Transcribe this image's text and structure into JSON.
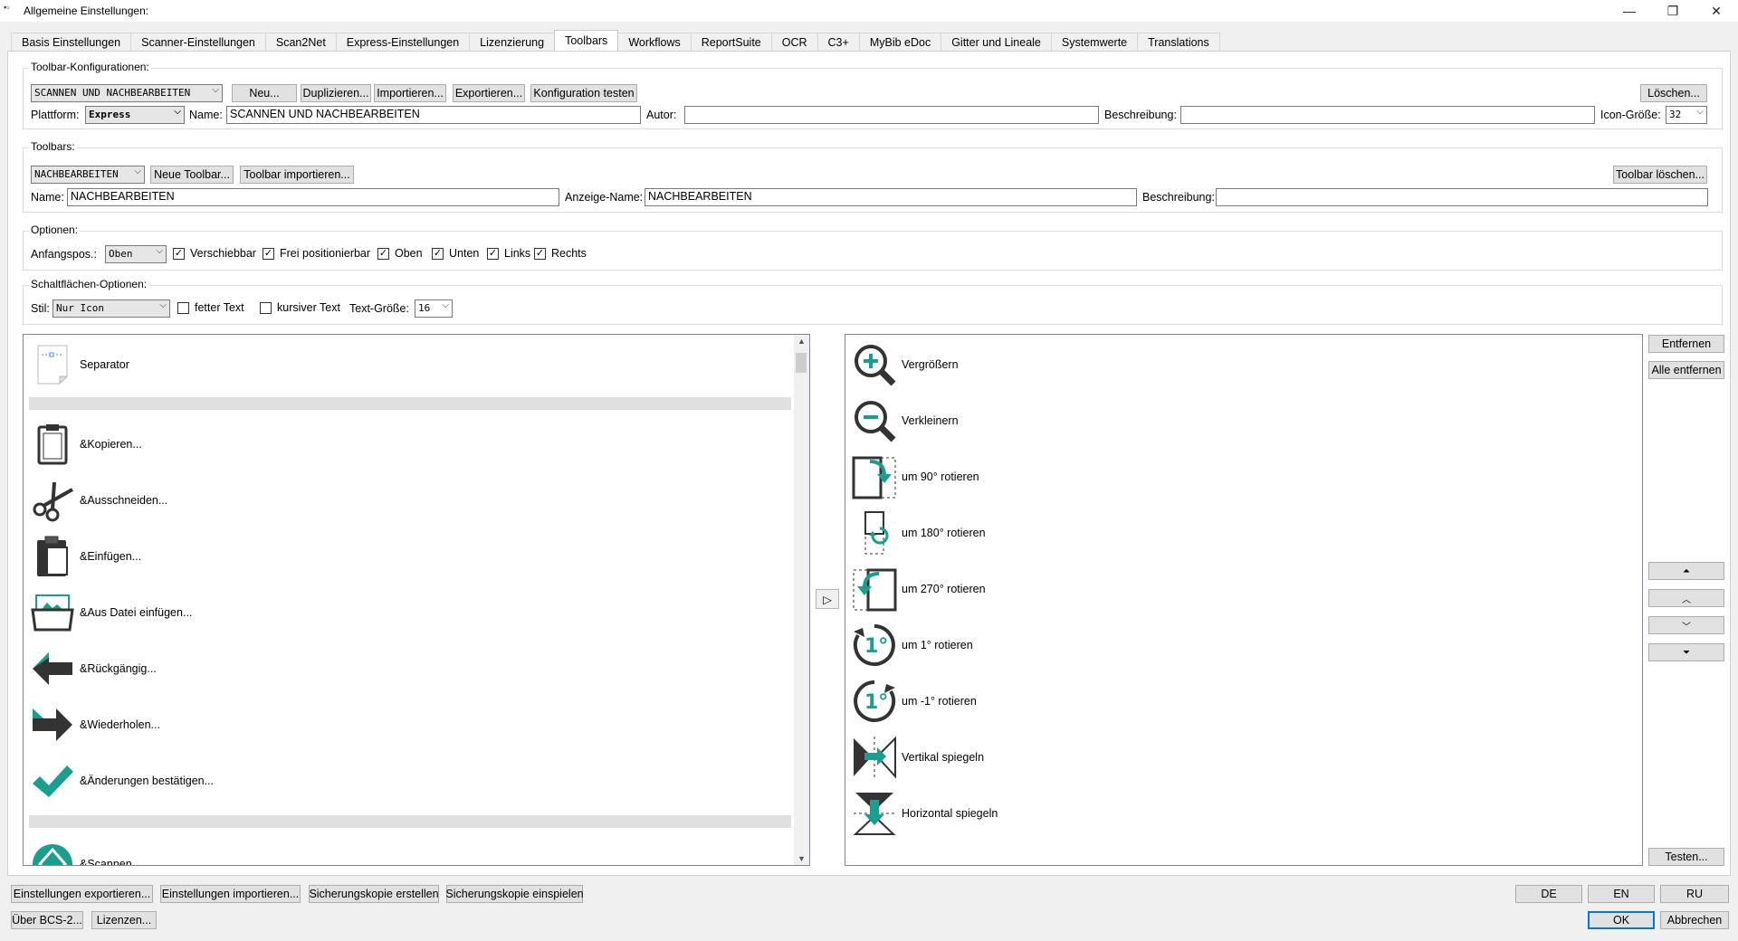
{
  "window": {
    "title": "Allgemeine Einstellungen:",
    "min": "—",
    "max": "❐",
    "close": "✕"
  },
  "tabs": [
    "Basis Einstellungen",
    "Scanner-Einstellungen",
    "Scan2Net",
    "Express-Einstellungen",
    "Lizenzierung",
    "Toolbars",
    "Workflows",
    "ReportSuite",
    "OCR",
    "C3+",
    "MyBib eDoc",
    "Gitter und Lineale",
    "Systemwerte",
    "Translations"
  ],
  "config": {
    "group_label": "Toolbar-Konfigurationen:",
    "selected": "SCANNEN UND NACHBEARBEITEN",
    "btn_new": "Neu...",
    "btn_dup": "Duplizieren...",
    "btn_import": "Importieren...",
    "btn_export": "Exportieren...",
    "btn_test": "Konfiguration testen",
    "btn_delete": "Löschen...",
    "platform_label": "Plattform:",
    "platform_value": "Express",
    "name_label": "Name:",
    "name_value": "SCANNEN UND NACHBEARBEITEN",
    "author_label": "Autor:",
    "author_value": "",
    "desc_label": "Beschreibung:",
    "desc_value": "",
    "icon_size_label": "Icon-Größe:",
    "icon_size_value": "32"
  },
  "toolbars": {
    "group_label": "Toolbars:",
    "selected": "NACHBEARBEITEN",
    "btn_new": "Neue Toolbar...",
    "btn_import": "Toolbar importieren...",
    "btn_delete": "Toolbar löschen...",
    "name_label": "Name:",
    "name_value": "NACHBEARBEITEN",
    "display_label": "Anzeige-Name:",
    "display_value": "NACHBEARBEITEN",
    "desc_label": "Beschreibung:",
    "desc_value": ""
  },
  "options": {
    "group_label": "Optionen:",
    "start_label": "Anfangspos.:",
    "start_value": "Oben",
    "movable": "Verschiebbar",
    "free": "Frei positionierbar",
    "top": "Oben",
    "bottom": "Unten",
    "left": "Links",
    "right": "Rechts",
    "check": "✓"
  },
  "button_options": {
    "group_label": "Schaltflächen-Optionen:",
    "style_label": "Stil:",
    "style_value": "Nur Icon",
    "bold": "fetter Text",
    "italic": "kursiver Text",
    "size_label": "Text-Größe:",
    "size_value": "16"
  },
  "available": {
    "separator": "Separator",
    "items": [
      "&Kopieren...",
      "&Ausschneiden...",
      "&Einfügen...",
      "&Aus Datei einfügen...",
      "&Rückgängig...",
      "&Wiederholen...",
      "&Änderungen bestätigen..."
    ],
    "after": "&Scannen..."
  },
  "add_arrow": "▷",
  "selected_items": [
    "Vergrößern",
    "Verkleinern",
    "um 90° rotieren",
    "um 180° rotieren",
    "um 270° rotieren",
    "um 1° rotieren",
    "um -1° rotieren",
    "Vertikal spiegeln",
    "Horizontal spiegeln"
  ],
  "side_buttons": {
    "remove": "Entfernen",
    "remove_all": "Alle entfernen",
    "top": "⏶",
    "up": "︿",
    "down": "﹀",
    "bottom": "⏷",
    "test": "Testen..."
  },
  "footer": {
    "export": "Einstellungen exportieren...",
    "import": "Einstellungen importieren...",
    "backup": "Sicherungskopie erstellen",
    "restore": "Sicherungskopie einspielen",
    "about": "Über BCS-2...",
    "licenses": "Lizenzen...",
    "de": "DE",
    "en": "EN",
    "ru": "RU",
    "ok": "OK",
    "cancel": "Abbrechen"
  },
  "colors": {
    "teal": "#1a9e8f",
    "dark": "#333333"
  }
}
